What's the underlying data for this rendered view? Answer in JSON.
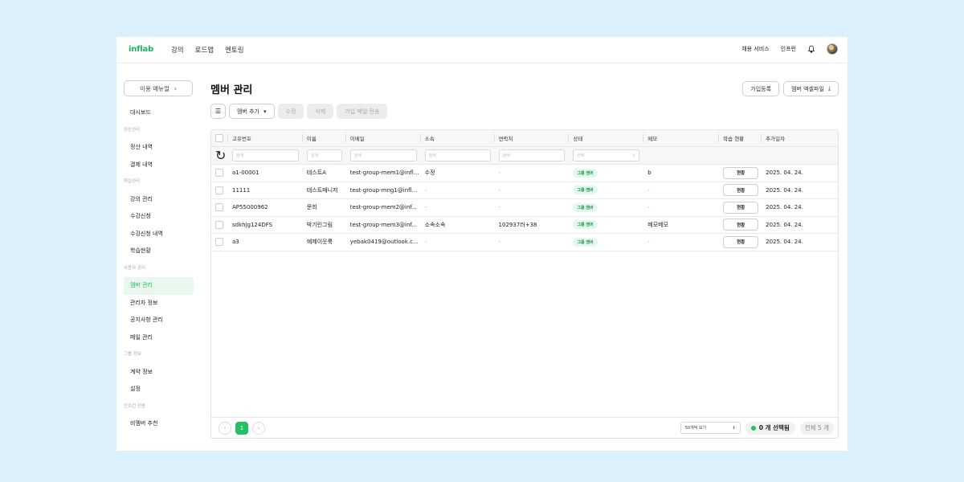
{
  "app": {
    "logo": "inflab"
  },
  "nav": [
    "강의",
    "로드맵",
    "멘토링"
  ],
  "top_right": [
    "채용 서비스",
    "인프런"
  ],
  "sidebar": {
    "guide_button": "이용 매뉴얼",
    "items": [
      {
        "type": "item",
        "label": "대시보드"
      },
      {
        "type": "section",
        "label": "정산관리"
      },
      {
        "type": "item",
        "label": "정산 내역"
      },
      {
        "type": "item",
        "label": "결제 내역"
      },
      {
        "type": "section",
        "label": "학습관리"
      },
      {
        "type": "item",
        "label": "강의 관리"
      },
      {
        "type": "item",
        "label": "수강신청"
      },
      {
        "type": "item",
        "label": "수강신청 내역"
      },
      {
        "type": "item",
        "label": "학습현황"
      },
      {
        "type": "section",
        "label": "사용자 관리"
      },
      {
        "type": "item",
        "label": "멤버 관리",
        "active": true
      },
      {
        "type": "item",
        "label": "관리자 정보"
      },
      {
        "type": "item",
        "label": "공지사항 관리"
      },
      {
        "type": "item",
        "label": "메일 관리"
      },
      {
        "type": "section",
        "label": "그룹 정보"
      },
      {
        "type": "item",
        "label": "계약 정보"
      },
      {
        "type": "item",
        "label": "설정"
      },
      {
        "type": "section",
        "label": "인프런 전용"
      },
      {
        "type": "item",
        "label": "비멤버 추천"
      }
    ]
  },
  "main": {
    "title": "멤버 관리",
    "header_buttons": {
      "join": "가입등록",
      "excel": "멤버 엑셀파일"
    },
    "toolbar": {
      "add": "멤버 추가",
      "edit": "수정",
      "delete": "삭제",
      "mail": "가입 메일 전송"
    },
    "columns": [
      "고유번호",
      "이름",
      "이메일",
      "소속",
      "연락처",
      "상태",
      "메모",
      "학습 현황",
      "추가일자"
    ],
    "filters": {
      "search": "검색",
      "select": "선택"
    },
    "rows": [
      {
        "id": "a1-00001",
        "name": "테스트A",
        "email": "test-group-mem1@infl...",
        "org": "수정",
        "phone": "-",
        "status": "그룹 멤버",
        "memo": "b",
        "progress": "현황",
        "date": "2025. 04. 24."
      },
      {
        "id": "11111",
        "name": "테스트매니저",
        "email": "test-group-mng1@infl...",
        "org": "-",
        "phone": "-",
        "status": "그룹 멤버",
        "memo": "-",
        "progress": "현황",
        "date": "2025. 04. 24."
      },
      {
        "id": "AP55000962",
        "name": "문희",
        "email": "test-group-mem2@inf...",
        "org": "-",
        "phone": "-",
        "status": "그룹 멤버",
        "memo": "-",
        "progress": "현황",
        "date": "2025. 04. 24."
      },
      {
        "id": "sdkhjg124DFS",
        "name": "박기린그림",
        "email": "test-group-mem3@inf...",
        "org": "소속소속",
        "phone": "102937러+38",
        "status": "그룹 멤버",
        "memo": "메모메모",
        "progress": "현황",
        "date": "2025. 04. 24."
      },
      {
        "id": "a3",
        "name": "예제이웃룩",
        "email": "yebak0419@outlook.c...",
        "org": "-",
        "phone": "-",
        "status": "그룹 멤버",
        "memo": "-",
        "progress": "현황",
        "date": "2025. 04. 24."
      }
    ]
  },
  "footer": {
    "page": "1",
    "per_page": "50개씩 보기",
    "selected": "0 개 선택됨",
    "total": "전체 5 개"
  },
  "colors": {
    "accent": "#26c064",
    "background": "#dcf0fc"
  }
}
